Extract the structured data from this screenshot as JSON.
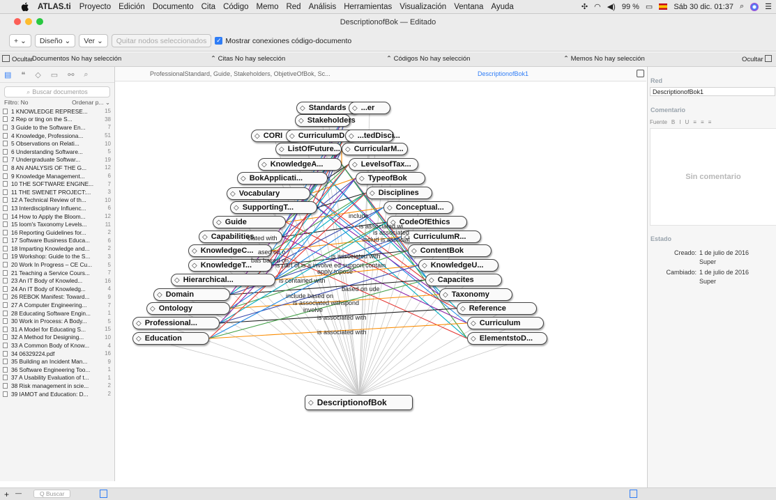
{
  "menubar": {
    "app": "ATLAS.ti",
    "items": [
      "Proyecto",
      "Edición",
      "Documento",
      "Cita",
      "Código",
      "Memo",
      "Red",
      "Análisis",
      "Herramientas",
      "Visualización",
      "Ventana",
      "Ayuda"
    ],
    "battery": "99 %",
    "datetime": "Sáb 30 dic. 01:37"
  },
  "window": {
    "title": "DescriptionofBok — Editado"
  },
  "toolbar": {
    "add": "+ ⌄",
    "design": "Diseño ⌄",
    "view": "Ver ⌄",
    "remove": "Quitar nodos seleccionados",
    "show_links": "Mostrar conexiones código-documento"
  },
  "filterbar": {
    "hide_left": "Ocultar",
    "documents": "Documentos  No hay selección",
    "quotes": "Citas  No hay selección",
    "codes": "Códigos  No hay selección",
    "memos": "Memos  No hay selección",
    "hide_right": "Ocultar"
  },
  "left": {
    "search_placeholder": "Buscar documentos",
    "filter": "Filtro: No",
    "sort": "Ordenar p... ⌄",
    "documents": [
      {
        "name": "1 KNOWLEDGE REPRESE...",
        "count": "15"
      },
      {
        "name": "2 Rep or ting on the S...",
        "count": "38"
      },
      {
        "name": "3 Guide to the Software En...",
        "count": "7"
      },
      {
        "name": "4 Knowledge, Professiona...",
        "count": "51"
      },
      {
        "name": "5 Observations on Relati...",
        "count": "10"
      },
      {
        "name": "6 Understanding Software...",
        "count": "5"
      },
      {
        "name": "7 Undergraduate Softwar...",
        "count": "19"
      },
      {
        "name": "8 AN ANALYSIS OF THE G...",
        "count": "12"
      },
      {
        "name": "9 Knowledge Management...",
        "count": "6"
      },
      {
        "name": "10 THE SOFTWARE ENGINE...",
        "count": "7"
      },
      {
        "name": "11 THE SWENET PROJECT:...",
        "count": "3"
      },
      {
        "name": "12 A Technical Review of th...",
        "count": "10"
      },
      {
        "name": "13 Interdisciplinary Influenc...",
        "count": "6"
      },
      {
        "name": "14 How to Apply the Bloom...",
        "count": "12"
      },
      {
        "name": "15 loom's Taxonomy Levels...",
        "count": "11"
      },
      {
        "name": "16 Reporting Guidelines for...",
        "count": "2"
      },
      {
        "name": "17 Software Business Educa...",
        "count": "6"
      },
      {
        "name": "18 Imparting Knowledge and...",
        "count": "2"
      },
      {
        "name": "19 Workshop: Guide to the S...",
        "count": "3"
      },
      {
        "name": "20 Work In Progress – CE Cu...",
        "count": "5"
      },
      {
        "name": "21 Teaching a Service Cours...",
        "count": "7"
      },
      {
        "name": "23 An IT Body of Knowled...",
        "count": "16"
      },
      {
        "name": "24 An IT Body of Knowledg...",
        "count": "4"
      },
      {
        "name": "26 REBOK Manifest: Toward...",
        "count": "9"
      },
      {
        "name": "27 A Computer Engineering...",
        "count": "7"
      },
      {
        "name": "28 Educating Software Engin...",
        "count": "1"
      },
      {
        "name": "30 Work in Process: A Body...",
        "count": "5"
      },
      {
        "name": "31 A Model for Educating S...",
        "count": "15"
      },
      {
        "name": "32 A Method for Designing...",
        "count": "10"
      },
      {
        "name": "33 A Common Body of Know...",
        "count": "4"
      },
      {
        "name": "34 06329224.pdf",
        "count": "16"
      },
      {
        "name": "35 Building an Incident Man...",
        "count": "9"
      },
      {
        "name": "36 Software Engineering Too...",
        "count": "1"
      },
      {
        "name": "37 A Usability Evaluation of t...",
        "count": "1"
      },
      {
        "name": "38 Risk management in scie...",
        "count": "2"
      },
      {
        "name": "39 IAMOT and Education: D...",
        "count": "2"
      }
    ]
  },
  "bottom": {
    "add": "+",
    "remove": "—",
    "search": "Q Buscar"
  },
  "canvas": {
    "codes_summary": "ProfessionalStandard, Guide, Stakeholders, ObjetiveOfBok, Sc...",
    "tab": "DescriptionofBok1"
  },
  "graph": {
    "root": "DescriptionofBok",
    "left_nodes": [
      "Standards",
      "Stakeholders",
      "CORI",
      "CurriculumD...",
      "ListOfFuture...",
      "KnowledgeA...",
      "BokApplicati...",
      "Vocabulary",
      "SupportingT...",
      "Guide",
      "Capabilities",
      "KnowledgeC...",
      "KnowledgeT...",
      "Hierarchical...",
      "Domain",
      "Ontology",
      "Professional...",
      "Education"
    ],
    "right_nodes": [
      "...er",
      "...tedDisci...",
      "CurricularM...",
      "LevelsofTax...",
      "TypeofBok",
      "Disciplines",
      "Conceptual...",
      "CodeOfEthics",
      "CurriculumR...",
      "ContentBok",
      "KnowledgeU...",
      "Capacites",
      "Taxonomy",
      "Reference",
      "Curriculum",
      "ElementstoD..."
    ],
    "edge_labels": [
      "include",
      "is associated wi",
      "is associated",
      "includ is associat",
      "ciated with",
      "ased on o",
      "is associated with",
      "bas based on",
      "is part of is a involve ed support contain",
      "apply topose",
      "is contained with",
      "based on ude",
      "include based on",
      "is associated withspond",
      "involve",
      "is associated with",
      "is associated with"
    ],
    "edge_colors": [
      "#e53935",
      "#1e88e5",
      "#43a047",
      "#fb8c00",
      "#8e24aa",
      "#00acc1",
      "#3949ab",
      "#222222"
    ]
  },
  "right": {
    "red_label": "Red",
    "name": "DescriptionofBok1",
    "comment_label": "Comentario",
    "format": [
      "Fuente",
      "B",
      "I",
      "U",
      "≡",
      "≡",
      "≡"
    ],
    "no_comment": "Sin comentario",
    "estado_label": "Estado",
    "created_label": "Creado:",
    "created": "1 de julio de 2016",
    "created_by": "Super",
    "changed_label": "Cambiado:",
    "changed": "1 de julio de 2016",
    "changed_by": "Super"
  }
}
